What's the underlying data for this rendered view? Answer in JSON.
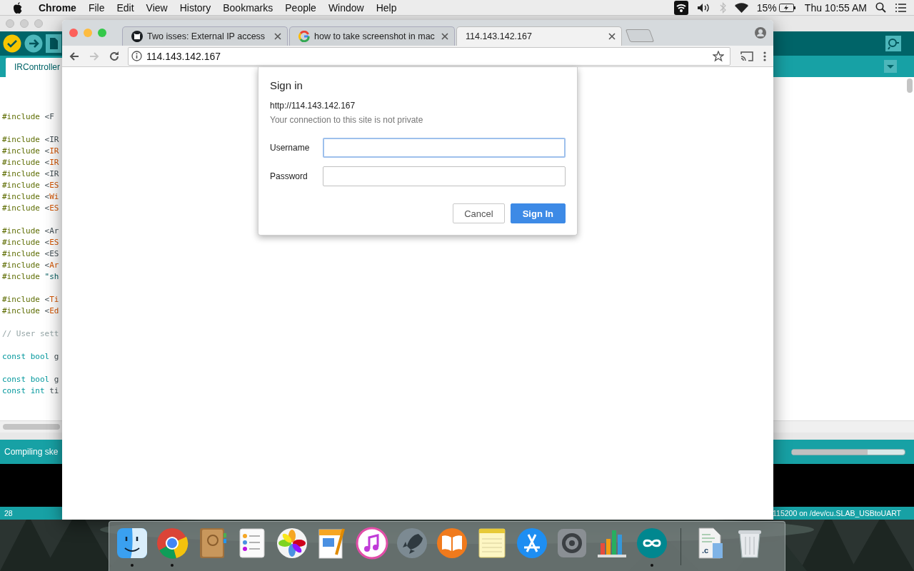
{
  "menu_bar": {
    "app": "Chrome",
    "items": [
      "File",
      "Edit",
      "View",
      "History",
      "Bookmarks",
      "People",
      "Window",
      "Help"
    ],
    "battery": "15%",
    "clock": "Thu 10:55 AM"
  },
  "arduino": {
    "sketch_tab": "IRController",
    "code": [
      [
        {
          "tokens": [
            {
              "kind": "directive",
              "text": "#include"
            },
            {
              "kind": "plain",
              "text": " <F"
            }
          ]
        }
      ],
      [
        {
          "tokens": [
            {
              "kind": "directive",
              "text": "#include"
            },
            {
              "kind": "plain",
              "text": " <IR"
            }
          ]
        },
        {
          "tokens": [
            {
              "kind": "directive",
              "text": "#include"
            },
            {
              "kind": "plain",
              "text": " <"
            },
            {
              "kind": "lib",
              "text": "IR"
            }
          ]
        },
        {
          "tokens": [
            {
              "kind": "directive",
              "text": "#include"
            },
            {
              "kind": "plain",
              "text": " <"
            },
            {
              "kind": "lib",
              "text": "IR"
            }
          ]
        },
        {
          "tokens": [
            {
              "kind": "directive",
              "text": "#include"
            },
            {
              "kind": "plain",
              "text": " <IR"
            }
          ]
        },
        {
          "tokens": [
            {
              "kind": "directive",
              "text": "#include"
            },
            {
              "kind": "plain",
              "text": " <"
            },
            {
              "kind": "lib",
              "text": "ES"
            }
          ]
        },
        {
          "tokens": [
            {
              "kind": "directive",
              "text": "#include"
            },
            {
              "kind": "plain",
              "text": " <"
            },
            {
              "kind": "lib",
              "text": "Wi"
            }
          ]
        },
        {
          "tokens": [
            {
              "kind": "directive",
              "text": "#include"
            },
            {
              "kind": "plain",
              "text": " <"
            },
            {
              "kind": "lib",
              "text": "ES"
            }
          ]
        }
      ],
      [
        {
          "tokens": [
            {
              "kind": "directive",
              "text": "#include"
            },
            {
              "kind": "plain",
              "text": " <Ar"
            }
          ]
        },
        {
          "tokens": [
            {
              "kind": "directive",
              "text": "#include"
            },
            {
              "kind": "plain",
              "text": " <"
            },
            {
              "kind": "lib",
              "text": "ES"
            }
          ]
        },
        {
          "tokens": [
            {
              "kind": "directive",
              "text": "#include"
            },
            {
              "kind": "plain",
              "text": " <ES"
            }
          ]
        },
        {
          "tokens": [
            {
              "kind": "directive",
              "text": "#include"
            },
            {
              "kind": "plain",
              "text": " <"
            },
            {
              "kind": "lib",
              "text": "Ar"
            }
          ]
        },
        {
          "tokens": [
            {
              "kind": "directive",
              "text": "#include"
            },
            {
              "kind": "string",
              "text": " \"sh"
            }
          ]
        }
      ],
      [
        {
          "tokens": [
            {
              "kind": "directive",
              "text": "#include"
            },
            {
              "kind": "plain",
              "text": " <"
            },
            {
              "kind": "lib",
              "text": "Ti"
            }
          ]
        },
        {
          "tokens": [
            {
              "kind": "directive",
              "text": "#include"
            },
            {
              "kind": "plain",
              "text": " <"
            },
            {
              "kind": "lib",
              "text": "Ed"
            }
          ]
        }
      ],
      [
        {
          "tokens": [
            {
              "kind": "comment",
              "text": "// User sett"
            }
          ]
        }
      ],
      [
        {
          "tokens": [
            {
              "kind": "type",
              "text": "const bool"
            },
            {
              "kind": "plain",
              "text": " g"
            }
          ]
        }
      ],
      [
        {
          "tokens": [
            {
              "kind": "type",
              "text": "const bool"
            },
            {
              "kind": "plain",
              "text": " g"
            }
          ]
        },
        {
          "tokens": [
            {
              "kind": "type",
              "text": "const int"
            },
            {
              "kind": "plain",
              "text": " ti"
            }
          ]
        }
      ]
    ],
    "status": "Compiling ske",
    "progress": {
      "level": 0.67
    },
    "line_number": "28",
    "port": "115200 on /dev/cu.SLAB_USBtoUART"
  },
  "browser": {
    "tabs": [
      {
        "title": "Two isses: External IP access",
        "kind": "github",
        "selected": false
      },
      {
        "title": "how to take screenshot in mac",
        "kind": "google",
        "selected": false
      },
      {
        "title": "114.143.142.167",
        "kind": "none",
        "selected": true
      }
    ],
    "nav_buttons": [
      {
        "kind": "back",
        "disabled": false
      },
      {
        "kind": "forward",
        "disabled": true
      },
      {
        "kind": "reload",
        "disabled": false
      }
    ],
    "address": "114.143.142.167"
  },
  "dialog": {
    "title": "Sign in",
    "origin": "http://114.143.142.167",
    "warning": "Your connection to this site is not private",
    "fields": [
      {
        "label": "Username",
        "focused": true
      },
      {
        "label": "Password",
        "focused": false
      }
    ],
    "buttons": [
      {
        "label": "Cancel",
        "kind": "secondary"
      },
      {
        "label": "Sign In",
        "kind": "primary"
      }
    ]
  },
  "dock": {
    "items": [
      {
        "kind": "finder",
        "running": true
      },
      {
        "kind": "chrome",
        "running": true
      },
      {
        "kind": "contacts",
        "running": false
      },
      {
        "kind": "reminders",
        "running": false
      },
      {
        "kind": "photos",
        "running": false
      },
      {
        "kind": "pages",
        "running": false
      },
      {
        "kind": "music",
        "running": false
      },
      {
        "kind": "launchpad",
        "running": false
      },
      {
        "kind": "books",
        "running": false
      },
      {
        "kind": "notes",
        "running": false
      },
      {
        "kind": "appstore",
        "running": false
      },
      {
        "kind": "settings",
        "running": false
      },
      {
        "kind": "numbers",
        "running": false
      },
      {
        "kind": "arduino",
        "running": true
      },
      {
        "kind": "separator"
      },
      {
        "kind": "document",
        "label": ".c",
        "running": false
      },
      {
        "kind": "trash",
        "running": false
      }
    ]
  }
}
